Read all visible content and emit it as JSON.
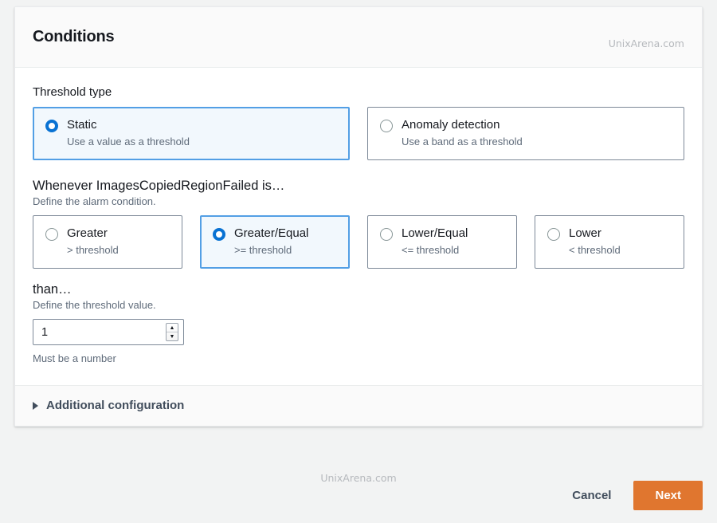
{
  "header": {
    "title": "Conditions",
    "watermark": "UnixArena.com"
  },
  "threshold_type": {
    "label": "Threshold type",
    "options": [
      {
        "title": "Static",
        "subtitle": "Use a value as a threshold",
        "selected": true
      },
      {
        "title": "Anomaly detection",
        "subtitle": "Use a band as a threshold",
        "selected": false
      }
    ]
  },
  "condition": {
    "heading": "Whenever ImagesCopiedRegionFailed is…",
    "description": "Define the alarm condition.",
    "options": [
      {
        "title": "Greater",
        "subtitle": "> threshold",
        "selected": false
      },
      {
        "title": "Greater/Equal",
        "subtitle": ">= threshold",
        "selected": true
      },
      {
        "title": "Lower/Equal",
        "subtitle": "<= threshold",
        "selected": false
      },
      {
        "title": "Lower",
        "subtitle": "< threshold",
        "selected": false
      }
    ]
  },
  "threshold_value": {
    "heading": "than…",
    "description": "Define the threshold value.",
    "value": "1",
    "placeholder": "",
    "helper": "Must be a number",
    "stepper_up": "▲",
    "stepper_down": "▼"
  },
  "additional_configuration": {
    "label": "Additional configuration",
    "expanded": false
  },
  "footer": {
    "watermark": "UnixArena.com",
    "cancel_label": "Cancel",
    "next_label": "Next"
  },
  "colors": {
    "accent_blue": "#0972d3",
    "selected_border": "#539fe5",
    "selected_fill": "#f2f8fd",
    "next_orange": "#e0762f",
    "page_background": "#f2f3f3"
  }
}
